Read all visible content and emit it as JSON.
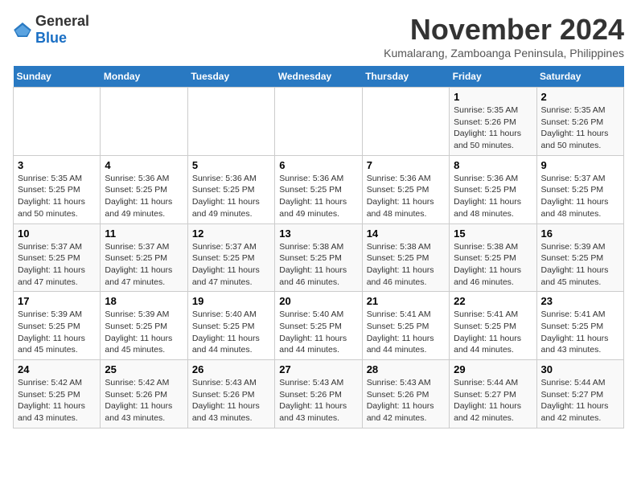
{
  "logo": {
    "general": "General",
    "blue": "Blue"
  },
  "title": "November 2024",
  "subtitle": "Kumalarang, Zamboanga Peninsula, Philippines",
  "days_of_week": [
    "Sunday",
    "Monday",
    "Tuesday",
    "Wednesday",
    "Thursday",
    "Friday",
    "Saturday"
  ],
  "weeks": [
    [
      {
        "day": "",
        "info": ""
      },
      {
        "day": "",
        "info": ""
      },
      {
        "day": "",
        "info": ""
      },
      {
        "day": "",
        "info": ""
      },
      {
        "day": "",
        "info": ""
      },
      {
        "day": "1",
        "info": "Sunrise: 5:35 AM\nSunset: 5:26 PM\nDaylight: 11 hours\nand 50 minutes."
      },
      {
        "day": "2",
        "info": "Sunrise: 5:35 AM\nSunset: 5:26 PM\nDaylight: 11 hours\nand 50 minutes."
      }
    ],
    [
      {
        "day": "3",
        "info": "Sunrise: 5:35 AM\nSunset: 5:25 PM\nDaylight: 11 hours\nand 50 minutes."
      },
      {
        "day": "4",
        "info": "Sunrise: 5:36 AM\nSunset: 5:25 PM\nDaylight: 11 hours\nand 49 minutes."
      },
      {
        "day": "5",
        "info": "Sunrise: 5:36 AM\nSunset: 5:25 PM\nDaylight: 11 hours\nand 49 minutes."
      },
      {
        "day": "6",
        "info": "Sunrise: 5:36 AM\nSunset: 5:25 PM\nDaylight: 11 hours\nand 49 minutes."
      },
      {
        "day": "7",
        "info": "Sunrise: 5:36 AM\nSunset: 5:25 PM\nDaylight: 11 hours\nand 48 minutes."
      },
      {
        "day": "8",
        "info": "Sunrise: 5:36 AM\nSunset: 5:25 PM\nDaylight: 11 hours\nand 48 minutes."
      },
      {
        "day": "9",
        "info": "Sunrise: 5:37 AM\nSunset: 5:25 PM\nDaylight: 11 hours\nand 48 minutes."
      }
    ],
    [
      {
        "day": "10",
        "info": "Sunrise: 5:37 AM\nSunset: 5:25 PM\nDaylight: 11 hours\nand 47 minutes."
      },
      {
        "day": "11",
        "info": "Sunrise: 5:37 AM\nSunset: 5:25 PM\nDaylight: 11 hours\nand 47 minutes."
      },
      {
        "day": "12",
        "info": "Sunrise: 5:37 AM\nSunset: 5:25 PM\nDaylight: 11 hours\nand 47 minutes."
      },
      {
        "day": "13",
        "info": "Sunrise: 5:38 AM\nSunset: 5:25 PM\nDaylight: 11 hours\nand 46 minutes."
      },
      {
        "day": "14",
        "info": "Sunrise: 5:38 AM\nSunset: 5:25 PM\nDaylight: 11 hours\nand 46 minutes."
      },
      {
        "day": "15",
        "info": "Sunrise: 5:38 AM\nSunset: 5:25 PM\nDaylight: 11 hours\nand 46 minutes."
      },
      {
        "day": "16",
        "info": "Sunrise: 5:39 AM\nSunset: 5:25 PM\nDaylight: 11 hours\nand 45 minutes."
      }
    ],
    [
      {
        "day": "17",
        "info": "Sunrise: 5:39 AM\nSunset: 5:25 PM\nDaylight: 11 hours\nand 45 minutes."
      },
      {
        "day": "18",
        "info": "Sunrise: 5:39 AM\nSunset: 5:25 PM\nDaylight: 11 hours\nand 45 minutes."
      },
      {
        "day": "19",
        "info": "Sunrise: 5:40 AM\nSunset: 5:25 PM\nDaylight: 11 hours\nand 44 minutes."
      },
      {
        "day": "20",
        "info": "Sunrise: 5:40 AM\nSunset: 5:25 PM\nDaylight: 11 hours\nand 44 minutes."
      },
      {
        "day": "21",
        "info": "Sunrise: 5:41 AM\nSunset: 5:25 PM\nDaylight: 11 hours\nand 44 minutes."
      },
      {
        "day": "22",
        "info": "Sunrise: 5:41 AM\nSunset: 5:25 PM\nDaylight: 11 hours\nand 44 minutes."
      },
      {
        "day": "23",
        "info": "Sunrise: 5:41 AM\nSunset: 5:25 PM\nDaylight: 11 hours\nand 43 minutes."
      }
    ],
    [
      {
        "day": "24",
        "info": "Sunrise: 5:42 AM\nSunset: 5:25 PM\nDaylight: 11 hours\nand 43 minutes."
      },
      {
        "day": "25",
        "info": "Sunrise: 5:42 AM\nSunset: 5:26 PM\nDaylight: 11 hours\nand 43 minutes."
      },
      {
        "day": "26",
        "info": "Sunrise: 5:43 AM\nSunset: 5:26 PM\nDaylight: 11 hours\nand 43 minutes."
      },
      {
        "day": "27",
        "info": "Sunrise: 5:43 AM\nSunset: 5:26 PM\nDaylight: 11 hours\nand 43 minutes."
      },
      {
        "day": "28",
        "info": "Sunrise: 5:43 AM\nSunset: 5:26 PM\nDaylight: 11 hours\nand 42 minutes."
      },
      {
        "day": "29",
        "info": "Sunrise: 5:44 AM\nSunset: 5:27 PM\nDaylight: 11 hours\nand 42 minutes."
      },
      {
        "day": "30",
        "info": "Sunrise: 5:44 AM\nSunset: 5:27 PM\nDaylight: 11 hours\nand 42 minutes."
      }
    ]
  ]
}
